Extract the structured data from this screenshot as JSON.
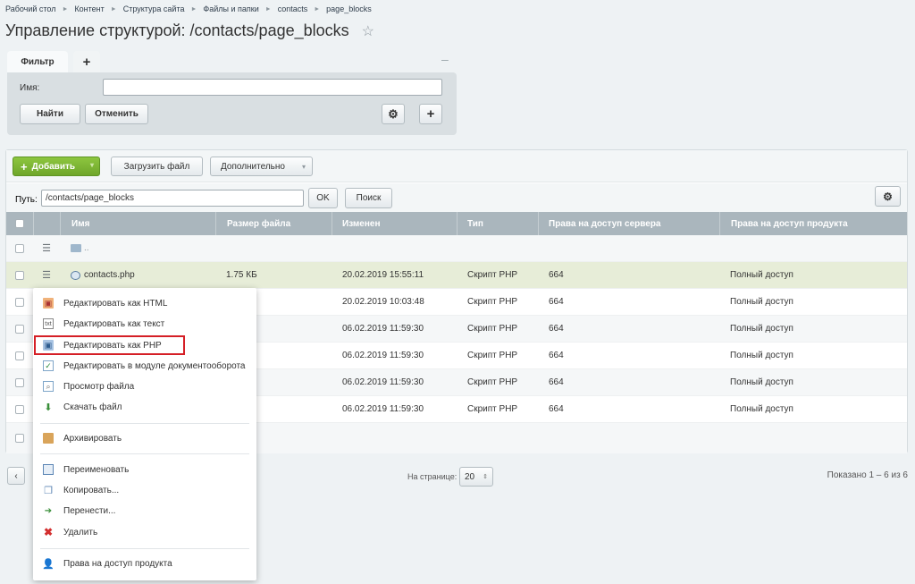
{
  "breadcrumb": [
    "Рабочий стол",
    "Контент",
    "Структура сайта",
    "Файлы и папки",
    "contacts",
    "page_blocks"
  ],
  "page_title": "Управление структурой: /contacts/page_blocks",
  "filter": {
    "tab_label": "Фильтр",
    "add_tab": "+",
    "minimize": "–",
    "name_label": "Имя:",
    "name_value": "",
    "find_label": "Найти",
    "cancel_label": "Отменить"
  },
  "toolbar": {
    "add_label": "Добавить",
    "upload_label": "Загрузить файл",
    "more_label": "Дополнительно"
  },
  "path": {
    "label": "Путь:",
    "value": "/contacts/page_blocks",
    "ok_label": "OK",
    "search_label": "Поиск"
  },
  "columns": [
    "Имя",
    "Размер файла",
    "Изменен",
    "Тип",
    "Права на доступ сервера",
    "Права на доступ продукта"
  ],
  "parent_row": {
    "name": ".."
  },
  "rows": [
    {
      "name": "contacts.php",
      "size": "1.75 КБ",
      "modified": "20.02.2019 15:55:11",
      "type": "Скрипт PHP",
      "server": "664",
      "product": "Полный доступ"
    },
    {
      "name": "",
      "size": "",
      "modified": "20.02.2019 10:03:48",
      "type": "Скрипт PHP",
      "server": "664",
      "product": "Полный доступ"
    },
    {
      "name": "",
      "size": "",
      "modified": "06.02.2019 11:59:30",
      "type": "Скрипт PHP",
      "server": "664",
      "product": "Полный доступ"
    },
    {
      "name": "",
      "size": "",
      "modified": "06.02.2019 11:59:30",
      "type": "Скрипт PHP",
      "server": "664",
      "product": "Полный доступ"
    },
    {
      "name": "",
      "size": "",
      "modified": "06.02.2019 11:59:30",
      "type": "Скрипт PHP",
      "server": "664",
      "product": "Полный доступ"
    },
    {
      "name": "",
      "size": "",
      "modified": "06.02.2019 11:59:30",
      "type": "Скрипт PHP",
      "server": "664",
      "product": "Полный доступ"
    }
  ],
  "context_menu": [
    {
      "label": "Редактировать как HTML",
      "icon": "edit-html-icon"
    },
    {
      "label": "Редактировать как текст",
      "icon": "edit-text-icon"
    },
    {
      "label": "Редактировать как PHP",
      "icon": "edit-php-icon"
    },
    {
      "label": "Редактировать в модуле документооборота",
      "icon": "workflow-icon"
    },
    {
      "label": "Просмотр файла",
      "icon": "view-file-icon"
    },
    {
      "label": "Скачать файл",
      "icon": "download-icon"
    },
    {
      "label": "Архивировать",
      "icon": "archive-icon"
    },
    {
      "label": "Переименовать",
      "icon": "rename-icon"
    },
    {
      "label": "Копировать...",
      "icon": "copy-icon"
    },
    {
      "label": "Перенести...",
      "icon": "move-icon"
    },
    {
      "label": "Удалить",
      "icon": "delete-icon"
    },
    {
      "label": "Права на доступ продукта",
      "icon": "permissions-icon"
    }
  ],
  "pager": {
    "per_page_label": "На странице:",
    "per_page_value": "20",
    "shown": "Показано 1 – 6 из 6"
  },
  "colors": {
    "accent_green": "#7ab733",
    "header": "#aab6bd",
    "highlight": "#d51f26"
  }
}
